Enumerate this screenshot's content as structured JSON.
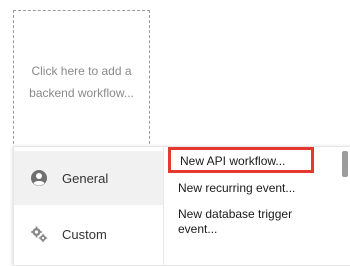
{
  "workflow_placeholder": {
    "text": "Click here to add a backend workflow..."
  },
  "menu": {
    "categories": [
      {
        "label": "General",
        "icon": "person-circle-icon"
      },
      {
        "label": "Custom",
        "icon": "gears-icon"
      }
    ],
    "options": [
      {
        "label": "New API workflow...",
        "highlighted": true
      },
      {
        "label": "New recurring event..."
      },
      {
        "label": "New database trigger event..."
      }
    ]
  },
  "colors": {
    "highlight_border": "#e5382f",
    "selected_category_bg": "#f1f1f1"
  }
}
